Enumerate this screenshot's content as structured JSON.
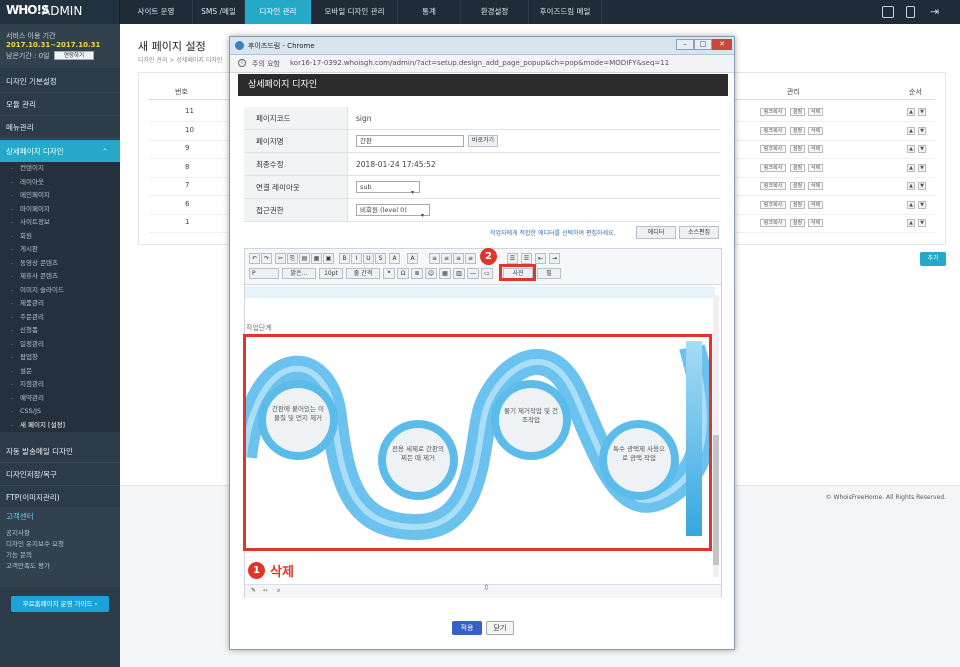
{
  "header": {
    "logo_mark": "WHO!S",
    "logo_text": "ADMIN",
    "nav": [
      "사이트 운영",
      "SMS /메일",
      "디자인 관리",
      "모바일 디자인 관리",
      "통계",
      "환경설정",
      "후이즈드림 메일"
    ]
  },
  "service": {
    "label": "서비스 이용 기간",
    "period": "2017.10.31~2017.10.31",
    "remaining": "남은기간 : 0일",
    "extend": "연장하기"
  },
  "sidebar": {
    "menu": [
      "디자인 기본설정",
      "모듈 관리",
      "메뉴관리",
      "상세페이지 디자인"
    ],
    "sub": [
      "컨텐이지",
      "레이아웃",
      "메인페이지",
      "마이페이지",
      "사이트정보",
      "회원",
      "게시판",
      "동영상 콘텐츠",
      "제휴사 콘텐츠",
      "이미지 슬라이드",
      "제품관리",
      "주문관리",
      "신청폼",
      "일정관리",
      "팝업창",
      "설문",
      "지점관리",
      "예약관리",
      "CSS/JS",
      "새 페이지 [설정]"
    ],
    "menu2": [
      "자동 발송메일 디자인",
      "디자인저장/복구",
      "FTP(이미지관리)"
    ],
    "cs_title": "고객센터",
    "cs_items": [
      "공지사항",
      "디자인 유지보수 요청",
      "기능 문의",
      "고객만족도 평가"
    ],
    "guide": "무료홈페이지 운영 가이드 ›"
  },
  "main": {
    "title": "새 페이지 설정",
    "breadcrumb": "디자인 관리 > 상세페이지 디자인",
    "col_no": "번호",
    "col_manage": "관리",
    "col_order": "순서",
    "rows": [
      "11",
      "10",
      "9",
      "8",
      "7",
      "6",
      "1"
    ],
    "btn_copy": "링크복사",
    "btn_set": "설정",
    "btn_del": "삭제",
    "up": "▲",
    "down": "▼",
    "add": "추가",
    "copyright": "© WhoisFreeHome. All Rights Reserved."
  },
  "popup": {
    "title": "후이즈드림 - Chrome",
    "secure": "주의 요함",
    "url": "kor16-17-0392.whoisgh.com/admin/?act=setup.design_add_page_popup&ch=pop&mode=MODIFY&seq=11",
    "heading": "상세페이지 디자인",
    "fields": [
      {
        "label": "페이지코드",
        "value": "sign"
      },
      {
        "label": "페이지명",
        "value": "간판"
      },
      {
        "label": "최종수정",
        "value": "2018-01-24 17:45:52"
      },
      {
        "label": "연결 레이아웃",
        "value": "sub"
      },
      {
        "label": "접근권한",
        "value": "비회원 (level 0)"
      }
    ],
    "preview": "바로가기",
    "editor_hint": "작업자에게 적합한 에디터를 선택하여 편집하세요.",
    "editor_btn": "에디터",
    "source_btn": "소스편집",
    "toolbar": {
      "para": "P",
      "font": "맑은...",
      "size": "10pt",
      "spacing": "줄 간격",
      "photo": "사진",
      "video": "필"
    },
    "doc_label": "작업단계",
    "steps": [
      "간판에 붙어있는 이물질 및 먼지 제거",
      "전용 세제로 간판의 찌든 때 제거",
      "물기 제거작업 및 건조작업",
      "특수 광택제 사용으로 광택 작업"
    ],
    "annot1": "삭제",
    "annot1_num": "1",
    "annot2_num": "2",
    "apply": "적용",
    "close": "닫기"
  }
}
